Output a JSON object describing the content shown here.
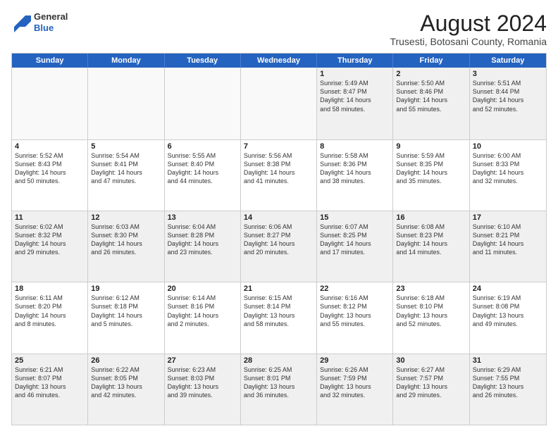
{
  "header": {
    "logo_line1": "General",
    "logo_line2": "Blue",
    "month_year": "August 2024",
    "location": "Trusesti, Botosani County, Romania"
  },
  "weekdays": [
    "Sunday",
    "Monday",
    "Tuesday",
    "Wednesday",
    "Thursday",
    "Friday",
    "Saturday"
  ],
  "rows": [
    [
      {
        "day": "",
        "text": ""
      },
      {
        "day": "",
        "text": ""
      },
      {
        "day": "",
        "text": ""
      },
      {
        "day": "",
        "text": ""
      },
      {
        "day": "1",
        "text": "Sunrise: 5:49 AM\nSunset: 8:47 PM\nDaylight: 14 hours\nand 58 minutes."
      },
      {
        "day": "2",
        "text": "Sunrise: 5:50 AM\nSunset: 8:46 PM\nDaylight: 14 hours\nand 55 minutes."
      },
      {
        "day": "3",
        "text": "Sunrise: 5:51 AM\nSunset: 8:44 PM\nDaylight: 14 hours\nand 52 minutes."
      }
    ],
    [
      {
        "day": "4",
        "text": "Sunrise: 5:52 AM\nSunset: 8:43 PM\nDaylight: 14 hours\nand 50 minutes."
      },
      {
        "day": "5",
        "text": "Sunrise: 5:54 AM\nSunset: 8:41 PM\nDaylight: 14 hours\nand 47 minutes."
      },
      {
        "day": "6",
        "text": "Sunrise: 5:55 AM\nSunset: 8:40 PM\nDaylight: 14 hours\nand 44 minutes."
      },
      {
        "day": "7",
        "text": "Sunrise: 5:56 AM\nSunset: 8:38 PM\nDaylight: 14 hours\nand 41 minutes."
      },
      {
        "day": "8",
        "text": "Sunrise: 5:58 AM\nSunset: 8:36 PM\nDaylight: 14 hours\nand 38 minutes."
      },
      {
        "day": "9",
        "text": "Sunrise: 5:59 AM\nSunset: 8:35 PM\nDaylight: 14 hours\nand 35 minutes."
      },
      {
        "day": "10",
        "text": "Sunrise: 6:00 AM\nSunset: 8:33 PM\nDaylight: 14 hours\nand 32 minutes."
      }
    ],
    [
      {
        "day": "11",
        "text": "Sunrise: 6:02 AM\nSunset: 8:32 PM\nDaylight: 14 hours\nand 29 minutes."
      },
      {
        "day": "12",
        "text": "Sunrise: 6:03 AM\nSunset: 8:30 PM\nDaylight: 14 hours\nand 26 minutes."
      },
      {
        "day": "13",
        "text": "Sunrise: 6:04 AM\nSunset: 8:28 PM\nDaylight: 14 hours\nand 23 minutes."
      },
      {
        "day": "14",
        "text": "Sunrise: 6:06 AM\nSunset: 8:27 PM\nDaylight: 14 hours\nand 20 minutes."
      },
      {
        "day": "15",
        "text": "Sunrise: 6:07 AM\nSunset: 8:25 PM\nDaylight: 14 hours\nand 17 minutes."
      },
      {
        "day": "16",
        "text": "Sunrise: 6:08 AM\nSunset: 8:23 PM\nDaylight: 14 hours\nand 14 minutes."
      },
      {
        "day": "17",
        "text": "Sunrise: 6:10 AM\nSunset: 8:21 PM\nDaylight: 14 hours\nand 11 minutes."
      }
    ],
    [
      {
        "day": "18",
        "text": "Sunrise: 6:11 AM\nSunset: 8:20 PM\nDaylight: 14 hours\nand 8 minutes."
      },
      {
        "day": "19",
        "text": "Sunrise: 6:12 AM\nSunset: 8:18 PM\nDaylight: 14 hours\nand 5 minutes."
      },
      {
        "day": "20",
        "text": "Sunrise: 6:14 AM\nSunset: 8:16 PM\nDaylight: 14 hours\nand 2 minutes."
      },
      {
        "day": "21",
        "text": "Sunrise: 6:15 AM\nSunset: 8:14 PM\nDaylight: 13 hours\nand 58 minutes."
      },
      {
        "day": "22",
        "text": "Sunrise: 6:16 AM\nSunset: 8:12 PM\nDaylight: 13 hours\nand 55 minutes."
      },
      {
        "day": "23",
        "text": "Sunrise: 6:18 AM\nSunset: 8:10 PM\nDaylight: 13 hours\nand 52 minutes."
      },
      {
        "day": "24",
        "text": "Sunrise: 6:19 AM\nSunset: 8:08 PM\nDaylight: 13 hours\nand 49 minutes."
      }
    ],
    [
      {
        "day": "25",
        "text": "Sunrise: 6:21 AM\nSunset: 8:07 PM\nDaylight: 13 hours\nand 46 minutes."
      },
      {
        "day": "26",
        "text": "Sunrise: 6:22 AM\nSunset: 8:05 PM\nDaylight: 13 hours\nand 42 minutes."
      },
      {
        "day": "27",
        "text": "Sunrise: 6:23 AM\nSunset: 8:03 PM\nDaylight: 13 hours\nand 39 minutes."
      },
      {
        "day": "28",
        "text": "Sunrise: 6:25 AM\nSunset: 8:01 PM\nDaylight: 13 hours\nand 36 minutes."
      },
      {
        "day": "29",
        "text": "Sunrise: 6:26 AM\nSunset: 7:59 PM\nDaylight: 13 hours\nand 32 minutes."
      },
      {
        "day": "30",
        "text": "Sunrise: 6:27 AM\nSunset: 7:57 PM\nDaylight: 13 hours\nand 29 minutes."
      },
      {
        "day": "31",
        "text": "Sunrise: 6:29 AM\nSunset: 7:55 PM\nDaylight: 13 hours\nand 26 minutes."
      }
    ]
  ]
}
